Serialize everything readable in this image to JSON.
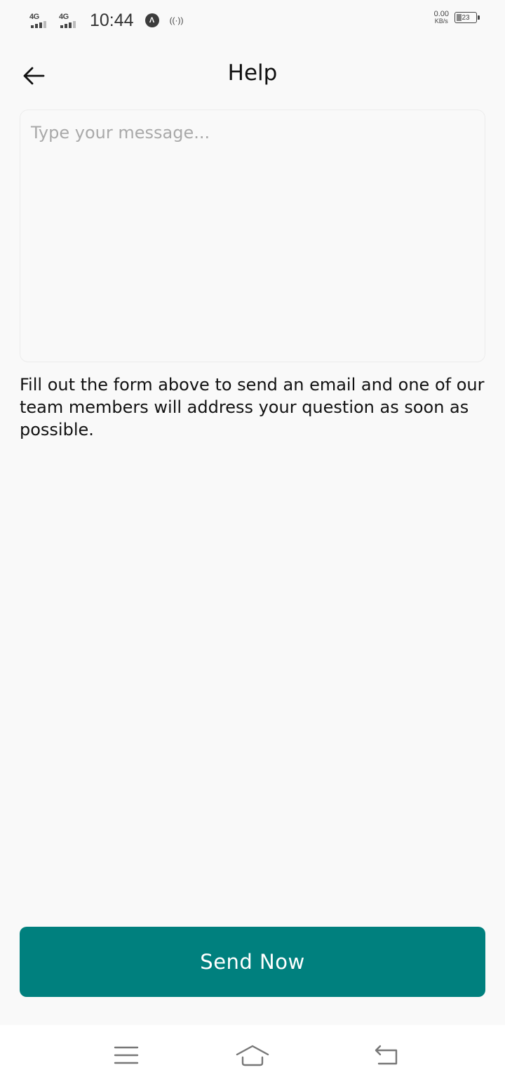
{
  "status_bar": {
    "signal1_label": "4G",
    "signal2_label": "4G",
    "time": "10:44",
    "app_icon_glyph": "Λ",
    "hotspot_glyph": "((·))",
    "speed_value": "0.00",
    "speed_unit": "KB/s",
    "battery_level": "23",
    "icons": [
      "signal-4g-icon",
      "signal-4g-icon",
      "app-notification-icon",
      "hotspot-icon",
      "battery-icon"
    ]
  },
  "header": {
    "title": "Help",
    "back_icon": "arrow-left-icon"
  },
  "form": {
    "message_placeholder": "Type your message...",
    "message_value": "",
    "help_text": "Fill out the form above to send an email and one of our team members will address your question as soon as possible.",
    "submit_label": "Send Now"
  },
  "nav_bar": {
    "icons": [
      "menu-icon",
      "home-icon",
      "back-icon"
    ]
  },
  "colors": {
    "background": "#f9f9f9",
    "accent": "#00807e",
    "text": "#111111",
    "placeholder": "#a9a9a9"
  }
}
